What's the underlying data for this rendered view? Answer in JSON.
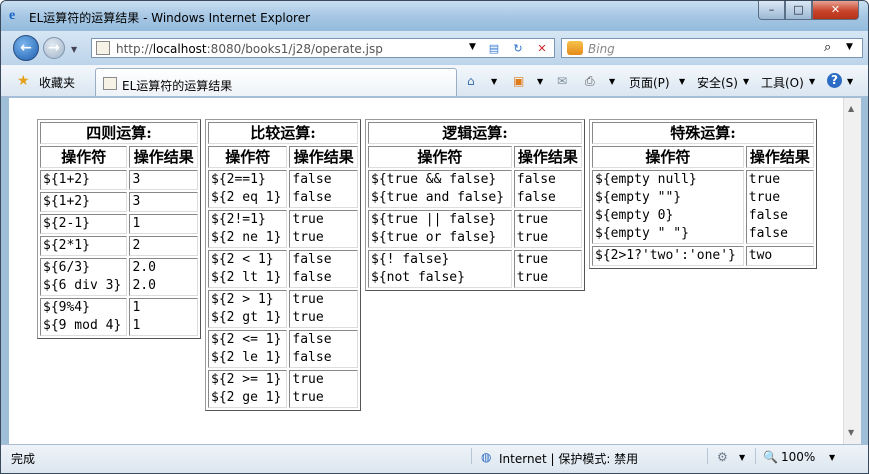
{
  "window": {
    "title": "EL运算符的运算结果 - Windows Internet Explorer",
    "minimize": "–",
    "maximize": "□",
    "close": "✕"
  },
  "address": {
    "url_prefix": "http://",
    "url_host": "localhost",
    "url_rest": ":8080/books1/j28/operate.jsp"
  },
  "search": {
    "placeholder": "Bing"
  },
  "favorites": {
    "label": "收藏夹"
  },
  "tab": {
    "label": "EL运算符的运算结果"
  },
  "toolbar": {
    "page": "页面(P)",
    "safety": "安全(S)",
    "tools": "工具(O)"
  },
  "status": {
    "left": "完成",
    "zone": "Internet | 保护模式: 禁用",
    "zoom": "100%"
  },
  "tables": {
    "arith": {
      "caption": "四则运算:",
      "h1": "操作符",
      "h2": "操作结果",
      "rows": [
        {
          "op": [
            "${1+2}"
          ],
          "res": [
            "3"
          ]
        },
        {
          "op": [
            "${1+2}"
          ],
          "res": [
            "3"
          ]
        },
        {
          "op": [
            "${2-1}"
          ],
          "res": [
            "1"
          ]
        },
        {
          "op": [
            "${2*1}"
          ],
          "res": [
            "2"
          ]
        },
        {
          "op": [
            "${6/3}",
            "${6 div 3}"
          ],
          "res": [
            "2.0",
            "2.0"
          ]
        },
        {
          "op": [
            "${9%4}",
            "${9 mod 4}"
          ],
          "res": [
            "1",
            "1"
          ]
        }
      ]
    },
    "compare": {
      "caption": "比较运算:",
      "h1": "操作符",
      "h2": "操作结果",
      "rows": [
        {
          "op": [
            "${2==1}",
            "${2 eq 1}"
          ],
          "res": [
            "false",
            "false"
          ]
        },
        {
          "op": [
            "${2!=1}",
            "${2 ne 1}"
          ],
          "res": [
            "true",
            "true"
          ]
        },
        {
          "op": [
            "${2 < 1}",
            "${2 lt 1}"
          ],
          "res": [
            "false",
            "false"
          ]
        },
        {
          "op": [
            "${2 > 1}",
            "${2 gt 1}"
          ],
          "res": [
            "true",
            "true"
          ]
        },
        {
          "op": [
            "${2 <= 1}",
            "${2 le 1}"
          ],
          "res": [
            "false",
            "false"
          ]
        },
        {
          "op": [
            "${2 >= 1}",
            "${2 ge 1}"
          ],
          "res": [
            "true",
            "true"
          ]
        }
      ]
    },
    "logic": {
      "caption": "逻辑运算:",
      "h1": "操作符",
      "h2": "操作结果",
      "rows": [
        {
          "op": [
            "${true && false}",
            "${true and false}"
          ],
          "res": [
            "false",
            "false"
          ]
        },
        {
          "op": [
            "${true || false}",
            "${true or false}"
          ],
          "res": [
            "true",
            "true"
          ]
        },
        {
          "op": [
            "${! false}",
            "${not false}"
          ],
          "res": [
            "true",
            "true"
          ]
        }
      ]
    },
    "special": {
      "caption": "特殊运算:",
      "h1": "操作符",
      "h2": "操作结果",
      "rows": [
        {
          "op": [
            "${empty null}",
            "${empty \"\"}",
            "${empty 0}",
            "${empty \" \"}"
          ],
          "res": [
            "true",
            "true",
            "false",
            "false"
          ]
        },
        {
          "op": [
            "${2>1?'two':'one'}"
          ],
          "res": [
            "two"
          ]
        }
      ]
    }
  }
}
